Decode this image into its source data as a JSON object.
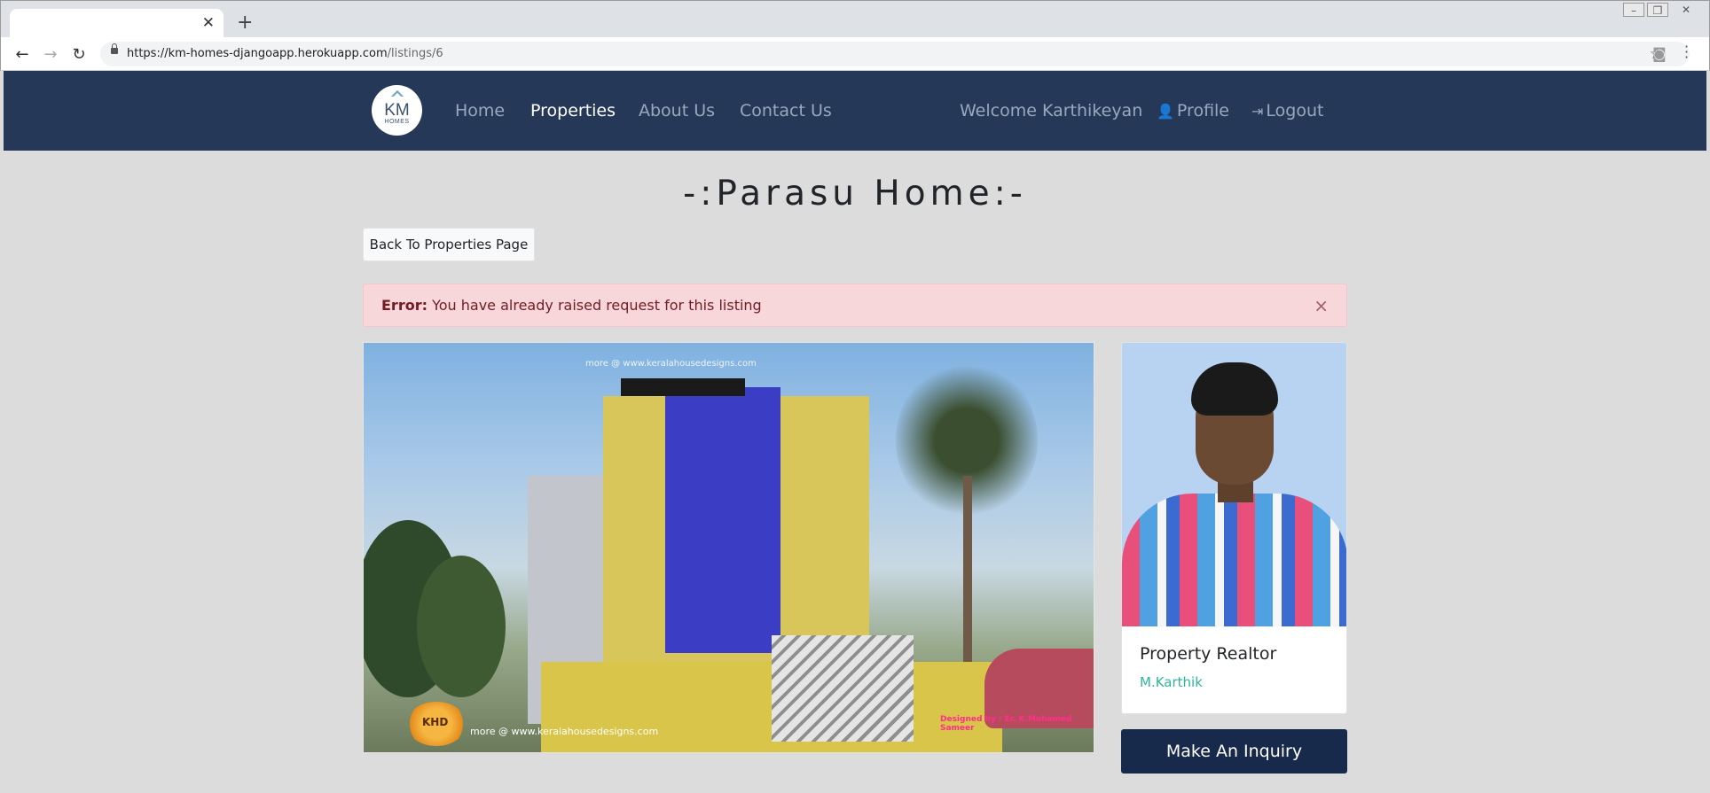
{
  "browser": {
    "tab_title": "",
    "tab_close": "✕",
    "new_tab": "+",
    "url_host": "https://km-homes-djangoapp.herokuapp.com",
    "url_path": "/listings/6"
  },
  "nav": {
    "logo_text": "KM",
    "logo_sub": "HOMES",
    "links": [
      "Home",
      "Properties",
      "About Us",
      "Contact Us"
    ],
    "active": "Properties",
    "welcome": "Welcome Karthikeyan",
    "profile": "Profile",
    "logout": "Logout"
  },
  "page": {
    "title": "-:Parasu Home:-",
    "back_button": "Back To Properties Page"
  },
  "alert": {
    "label": "Error:",
    "message": "You have already raised request for this listing",
    "close": "×"
  },
  "listing_image": {
    "watermark_top": "more @ www.keralahousedesigns.com",
    "watermark_bottom": "more @ www.keralahousedesigns.com",
    "logo_text": "KHD",
    "credit": "Designed by : Er. K.Mohamed Sameer"
  },
  "realtor": {
    "role": "Property Realtor",
    "name": "M.Karthik"
  },
  "inquiry_button": "Make An Inquiry"
}
